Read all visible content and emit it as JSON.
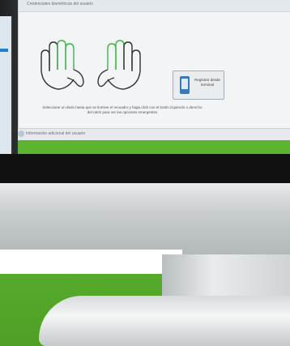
{
  "panel": {
    "header_title": "Credenciales biométricas del usuario",
    "hint": "Seleccione un dedo hasta que se ilumine el recuadro y haga click con el botón izquierdo o derecho del ratón para ver las opciones emergentes",
    "register_button_label": "Registrar desde terminal",
    "sub_section_title": "Información adicional del usuario"
  },
  "colors": {
    "accent": "#5aa832",
    "finger_highlight": "#3fb54a",
    "phone_icon": "#3a78b8"
  }
}
